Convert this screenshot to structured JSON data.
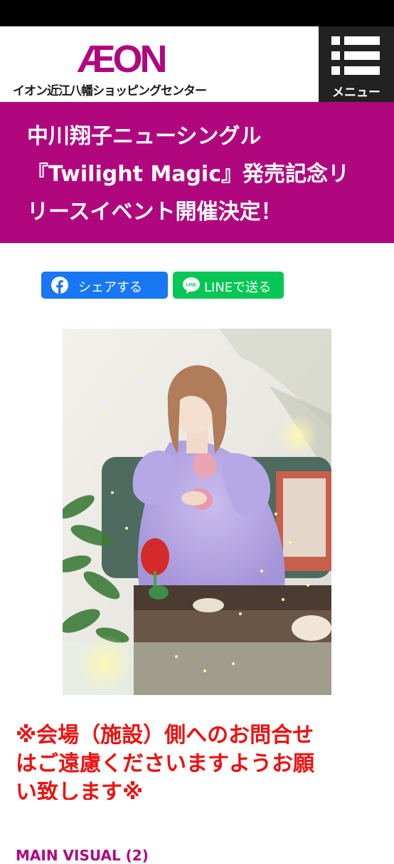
{
  "header": {
    "logo_mark": "ÆON",
    "logo_subtitle": "イオン近江八幡ショッピングセンター",
    "menu_label": "メニュー",
    "brand_color": "#b0077e"
  },
  "title": {
    "line1": "中川翔子ニューシングル",
    "line2": "『Twilight Magic』発売記念リ",
    "line3": "リースイベント開催決定！"
  },
  "share": {
    "facebook_label": "シェアする",
    "line_label": "LINEで送る",
    "line_icon_text": "LINE"
  },
  "notice": {
    "line1": "※会場（施設）側へのお問合せ",
    "line2": "はご遠慮くださいますようお願",
    "line3": "い致します※"
  },
  "next_heading": "MAIN VISUAL (2)"
}
